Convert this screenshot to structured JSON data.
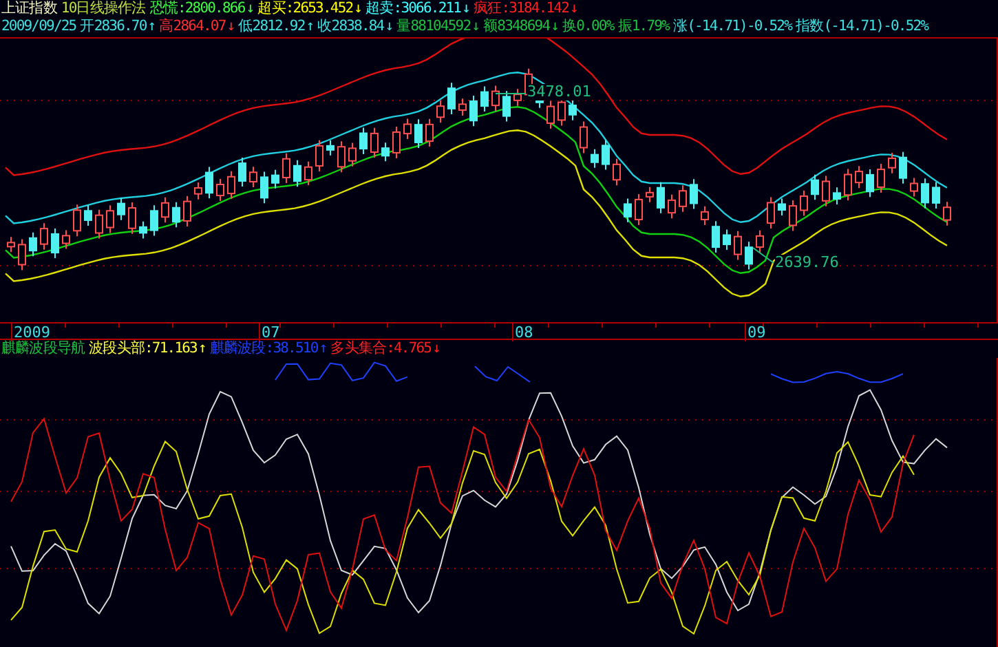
{
  "header": {
    "row_1": [
      {
        "text": "上证指数",
        "color": "#f0f0c0"
      },
      {
        "text": "10日线操作法",
        "color": "#c0e040"
      },
      {
        "text": "恐慌:2800.866",
        "arrow": "↓",
        "color": "#40ff40"
      },
      {
        "text": "超买:2653.452",
        "arrow": "↓",
        "color": "#ffff00"
      },
      {
        "text": "超卖:3066.211",
        "arrow": "↓",
        "color": "#40ffff"
      },
      {
        "text": "疯狂:3184.142",
        "arrow": "↓",
        "color": "#ff2020"
      }
    ],
    "row_2": [
      {
        "text": "2009/09/25",
        "color": "#40e0e0"
      },
      {
        "text": "开2836.70",
        "arrow": "↑",
        "color": "#40e0e0"
      },
      {
        "text": "高2864.07",
        "arrow": "↓",
        "color": "#ff3030"
      },
      {
        "text": "低2812.92",
        "arrow": "↑",
        "color": "#40e0e0"
      },
      {
        "text": "收2838.84",
        "arrow": "↓",
        "color": "#40e0e0"
      },
      {
        "text": "量88104592",
        "arrow": "↓",
        "color": "#20c040"
      },
      {
        "text": "额8348694",
        "arrow": "↓",
        "color": "#20c040"
      },
      {
        "text": "换0.00%",
        "color": "#20c040"
      },
      {
        "text": "振1.79%",
        "color": "#20c040"
      },
      {
        "text": "涨(-14.71)-0.52%",
        "color": "#40e0e0"
      },
      {
        "text": "指数(-14.71)-0.52%",
        "color": "#40e0e0"
      }
    ]
  },
  "price_chart": {
    "price_labels": [
      {
        "text": "3478.01"
      },
      {
        "text": "2639.76"
      }
    ]
  },
  "date_axis": {
    "labels": [
      "2009",
      "07",
      "08",
      "09"
    ]
  },
  "indicator_header": [
    {
      "text": "麒麟波段导航",
      "color": "#20c040"
    },
    {
      "text": "波段头部:71.163",
      "arrow": "↑",
      "color": "#ffff40"
    },
    {
      "text": "麒麟波段:38.510",
      "arrow": "↑",
      "color": "#2040ff"
    },
    {
      "text": "多头集合:4.765",
      "arrow": "↓",
      "color": "#ff2020"
    }
  ]
}
